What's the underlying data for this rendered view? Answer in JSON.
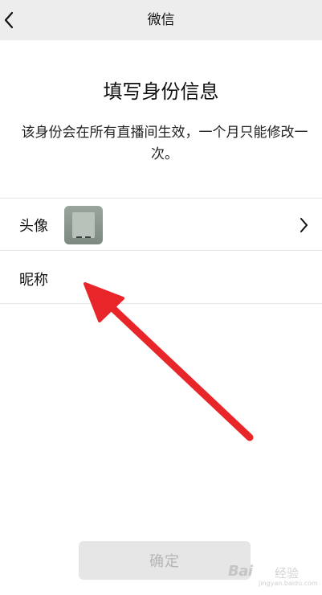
{
  "header": {
    "title": "微信",
    "back_icon": "chevron-left-icon"
  },
  "main": {
    "heading": "填写身份信息",
    "description": "该身份会在所有直播间生效，一个月只能修改一次。"
  },
  "form": {
    "avatar_label": "头像",
    "nickname_label": "昵称",
    "nickname_value": "",
    "avatar_icon": "photo-thumbnail",
    "chevron_icon": "chevron-right-icon"
  },
  "footer": {
    "confirm_label": "确定"
  },
  "annotation": {
    "arrow_color": "#e8262a"
  },
  "watermark": {
    "brand": "Bai",
    "brand_cn": "经验",
    "url": "jingyan.baidu.com"
  },
  "colors": {
    "nav_background": "#ededed",
    "button_background": "#e6e6e6",
    "button_text_disabled": "#b5b5b5",
    "divider": "#e6e6e6"
  }
}
